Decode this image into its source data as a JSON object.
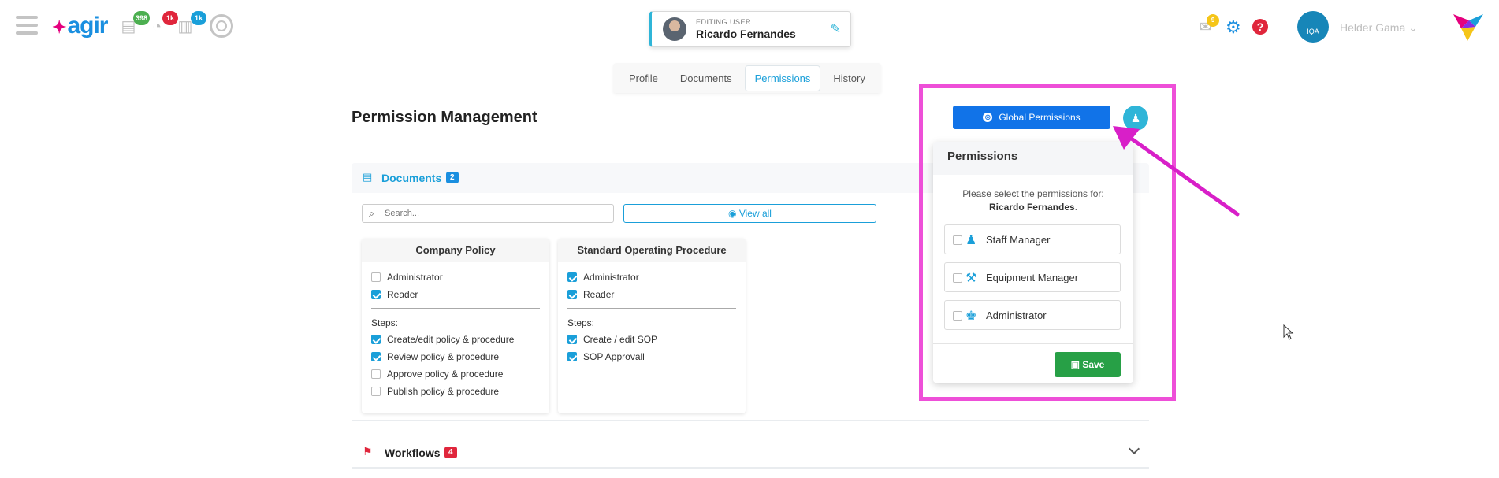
{
  "app": {
    "logo_text": "agir",
    "logo_mark": "✦"
  },
  "topbar": {
    "badges": [
      {
        "name": "documents",
        "count": "398",
        "color": "#4caf50"
      },
      {
        "name": "analytics",
        "count": "1k",
        "color": "#e0263c"
      },
      {
        "name": "tasks",
        "count": "1k",
        "color": "#1a9fd9"
      }
    ],
    "notification_count": "9",
    "user_name": "Helder Gama",
    "avatar_text": "IQA"
  },
  "editing_user": {
    "label": "EDITING USER",
    "name": "Ricardo Fernandes"
  },
  "tabs": [
    {
      "label": "Profile",
      "active": false
    },
    {
      "label": "Documents",
      "active": false
    },
    {
      "label": "Permissions",
      "active": true
    },
    {
      "label": "History",
      "active": false
    }
  ],
  "page_title": "Permission Management",
  "documents": {
    "title": "Documents",
    "count": "2",
    "search_placeholder": "Search...",
    "view_all_label": "View all",
    "cards": [
      {
        "title": "Company Policy",
        "roles": [
          {
            "label": "Administrator",
            "checked": false
          },
          {
            "label": "Reader",
            "checked": true
          }
        ],
        "steps_label": "Steps:",
        "steps": [
          {
            "label": "Create/edit policy & procedure",
            "checked": true
          },
          {
            "label": "Review policy & procedure",
            "checked": true
          },
          {
            "label": "Approve policy & procedure",
            "checked": false
          },
          {
            "label": "Publish policy & procedure",
            "checked": false
          }
        ]
      },
      {
        "title": "Standard Operating Procedure",
        "roles": [
          {
            "label": "Administrator",
            "checked": true
          },
          {
            "label": "Reader",
            "checked": true
          }
        ],
        "steps_label": "Steps:",
        "steps": [
          {
            "label": "Create / edit SOP",
            "checked": true
          },
          {
            "label": "SOP Approvall",
            "checked": true
          }
        ]
      }
    ]
  },
  "workflows": {
    "title": "Workflows",
    "count": "4"
  },
  "global_permissions": {
    "button_label": "Global Permissions",
    "panel_title": "Permissions",
    "info_text": "Please select the permissions for:",
    "user_name": "Ricardo Fernandes",
    "options": [
      {
        "label": "Staff Manager",
        "icon": "users-icon",
        "checked": false
      },
      {
        "label": "Equipment Manager",
        "icon": "wrench-icon",
        "checked": false
      },
      {
        "label": "Administrator",
        "icon": "user-cog-icon",
        "checked": false
      }
    ],
    "save_label": "Save"
  },
  "colors": {
    "accent": "#1a9fd9",
    "primary_button": "#1173e8",
    "save_button": "#27a046",
    "highlight": "#ee4fd8",
    "danger": "#e0263c"
  }
}
